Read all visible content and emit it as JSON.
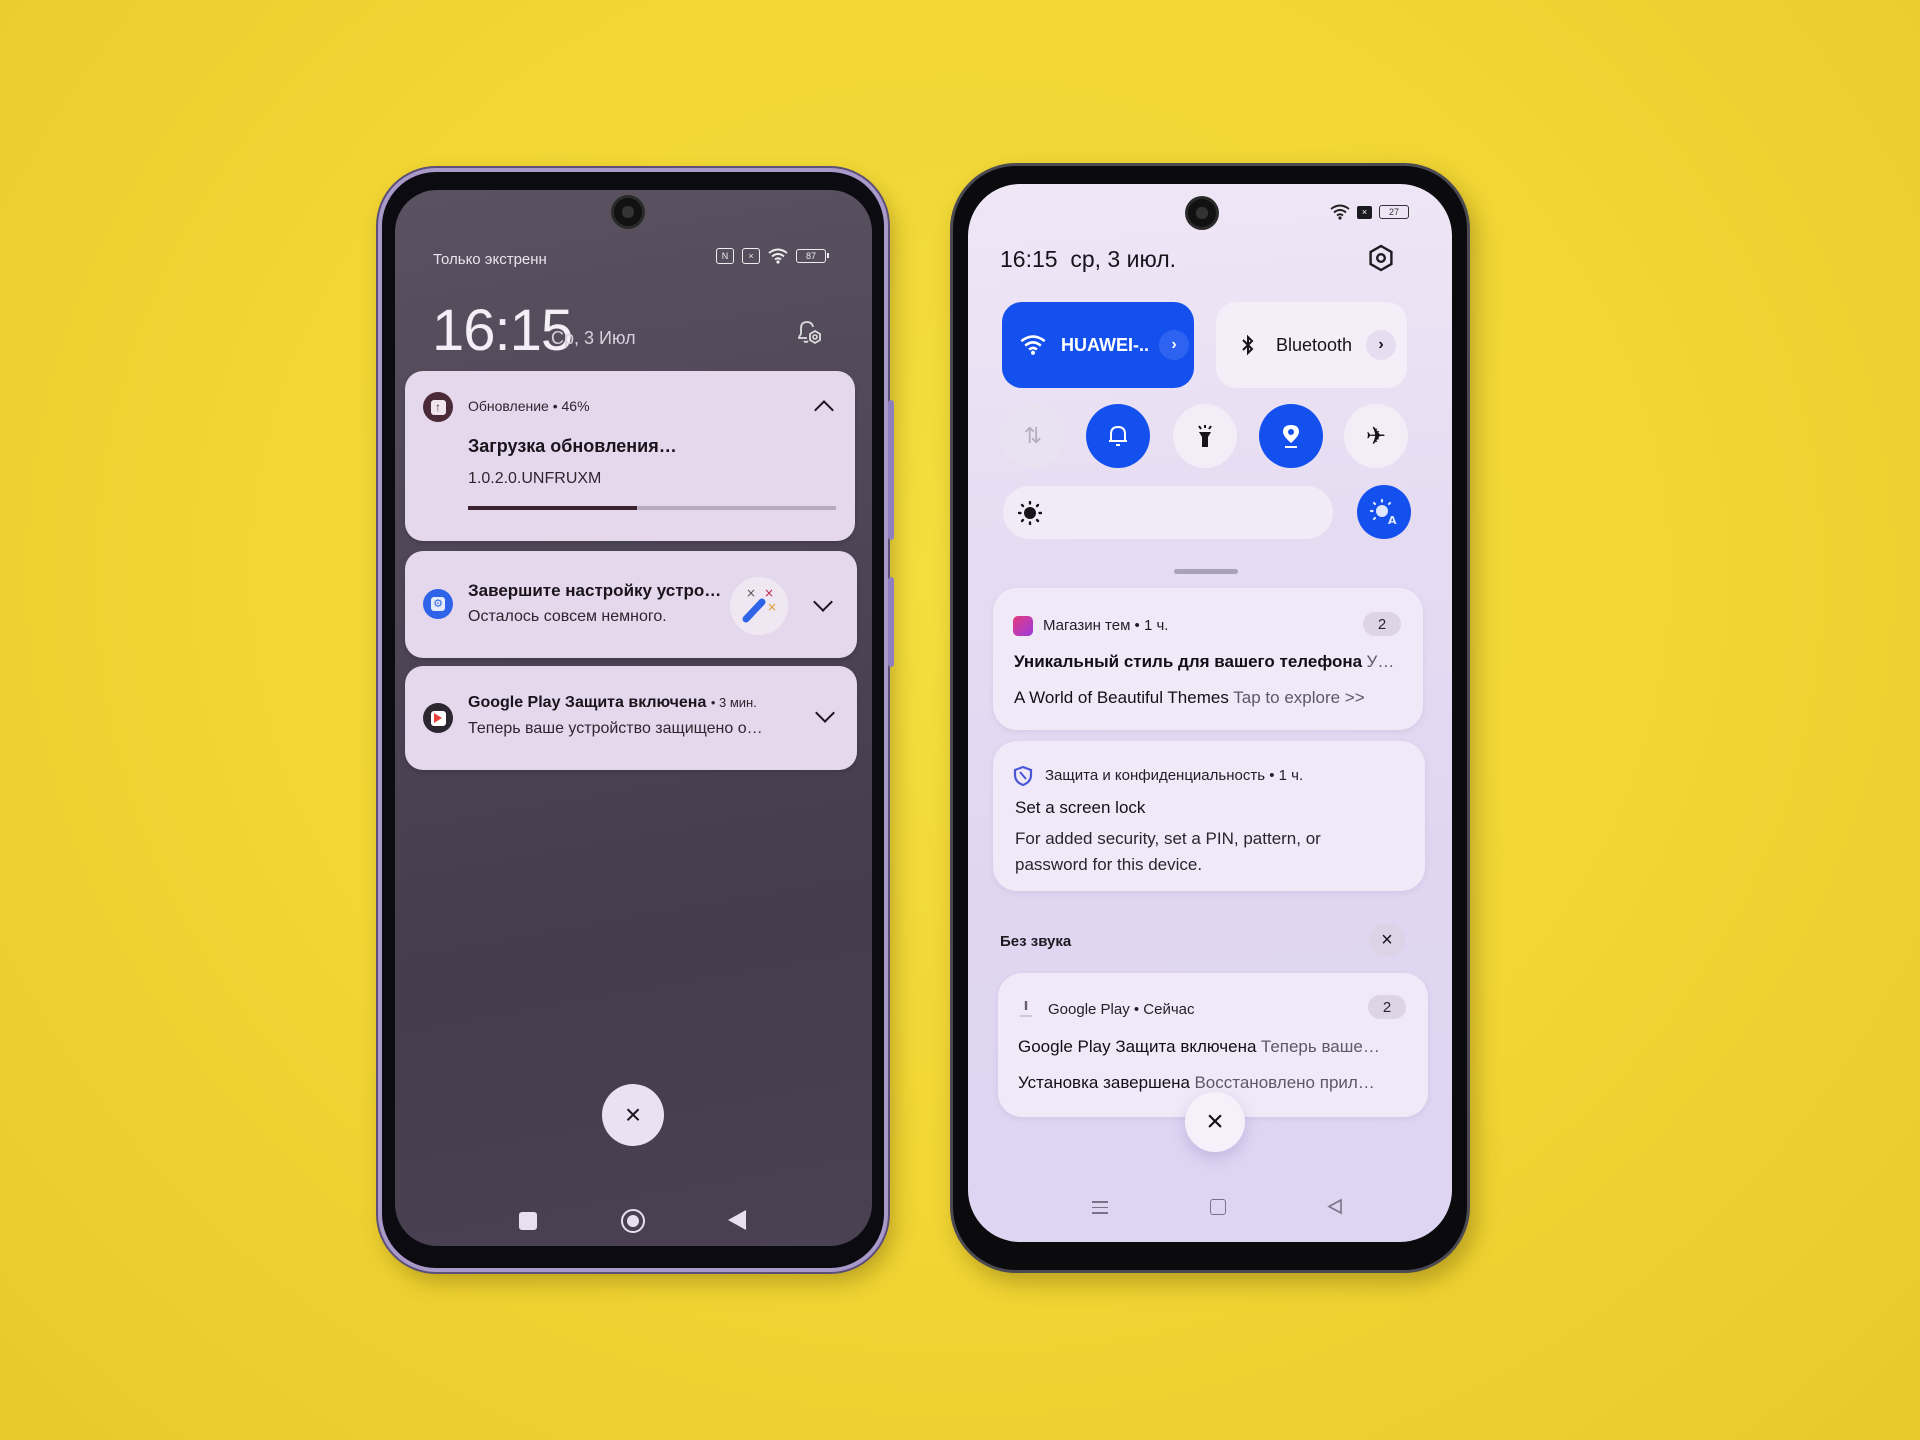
{
  "left_phone": {
    "status": {
      "carrier_text": "Только экстренн",
      "battery": "87",
      "icons": [
        "nfc-icon",
        "no-sim-icon",
        "wifi-icon",
        "battery-icon"
      ]
    },
    "clock": {
      "time": "16:15",
      "date": "Ср, 3 Июл"
    },
    "notifications": [
      {
        "icon": "system-update-icon",
        "meta": "Обновление • 46%",
        "title": "Загрузка обновления…",
        "text": "1.0.2.0.UNFRUXM",
        "progress_percent": 46,
        "expanded": true
      },
      {
        "icon": "settings-icon",
        "title": "Завершите настройку устро…",
        "text": "Осталось совсем немного.",
        "thumbnail": "magic-wand-icon",
        "expanded": false
      },
      {
        "icon": "google-play-icon",
        "title": "Google Play Защита включена",
        "time": "• 3 мин.",
        "text": "Теперь ваше устройство защищено о…",
        "expanded": false
      }
    ],
    "clear_all_label": "×",
    "nav": [
      "recents-button",
      "home-button",
      "back-button"
    ]
  },
  "right_phone": {
    "status": {
      "battery": "27",
      "icons": [
        "wifi-icon",
        "no-sim-icon",
        "battery-icon"
      ]
    },
    "header": {
      "time": "16:15",
      "date": "ср, 3 июл."
    },
    "tiles": [
      {
        "label": "HUAWEI-..",
        "icon": "wifi-icon",
        "active": true
      },
      {
        "label": "Bluetooth",
        "icon": "bluetooth-icon",
        "active": false
      }
    ],
    "toggles": [
      {
        "name": "mobile-data",
        "active": false,
        "disabled": true
      },
      {
        "name": "sound",
        "active": true
      },
      {
        "name": "flashlight",
        "active": false
      },
      {
        "name": "location",
        "active": true
      },
      {
        "name": "airplane-mode",
        "active": false
      }
    ],
    "brightness": {
      "auto": true
    },
    "notifications": [
      {
        "icon": "theme-store-icon",
        "meta": "Магазин тем • 1 ч.",
        "count": "2",
        "lines": [
          {
            "bold": "Уникальный стиль для вашего телефона",
            "sub": "У…"
          },
          {
            "bold": "A World of Beautiful Themes",
            "sub": "Tap to explore >>"
          }
        ]
      },
      {
        "icon": "shield-icon",
        "meta": "Защита и конфиденциальность • 1 ч.",
        "title": "Set a screen lock",
        "text": "For added security, set a PIN, pattern, or password for this device."
      }
    ],
    "silent_section": {
      "label": "Без звука",
      "clear_label": "×",
      "notifications": [
        {
          "icon": "download-icon",
          "meta": "Google Play • Сейчас",
          "count": "2",
          "lines": [
            {
              "bold": "Google Play Защита включена",
              "sub": "Теперь ваше…"
            },
            {
              "bold": "Установка завершена",
              "sub": "Восстановлено прил…"
            }
          ]
        }
      ]
    },
    "clear_all_label": "×",
    "nav": [
      "menu-button",
      "home-button",
      "back-button"
    ]
  }
}
